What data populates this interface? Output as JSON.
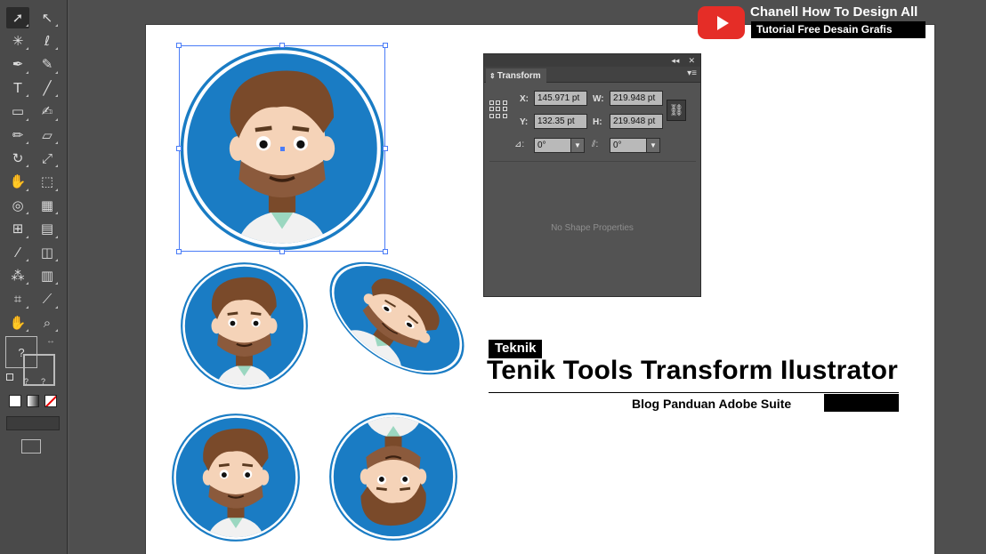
{
  "toolbar": {
    "tools": [
      {
        "name": "selection-tool-icon",
        "glyph": "➚",
        "selected": true
      },
      {
        "name": "direct-selection-tool-icon",
        "glyph": "↖"
      },
      {
        "name": "magic-wand-tool-icon",
        "glyph": "✳"
      },
      {
        "name": "lasso-tool-icon",
        "glyph": "ℓ"
      },
      {
        "name": "pen-tool-icon",
        "glyph": "✒"
      },
      {
        "name": "curvature-tool-icon",
        "glyph": "✎"
      },
      {
        "name": "type-tool-icon",
        "glyph": "T"
      },
      {
        "name": "line-tool-icon",
        "glyph": "╱"
      },
      {
        "name": "rectangle-tool-icon",
        "glyph": "▭"
      },
      {
        "name": "paintbrush-tool-icon",
        "glyph": "✍"
      },
      {
        "name": "pencil-tool-icon",
        "glyph": "✏"
      },
      {
        "name": "eraser-tool-icon",
        "glyph": "▱"
      },
      {
        "name": "rotate-tool-icon",
        "glyph": "↻"
      },
      {
        "name": "scale-tool-icon",
        "glyph": "⤢"
      },
      {
        "name": "warp-tool-icon",
        "glyph": "✋"
      },
      {
        "name": "free-transform-tool-icon",
        "glyph": "⬚"
      },
      {
        "name": "shape-builder-tool-icon",
        "glyph": "◎"
      },
      {
        "name": "perspective-grid-tool-icon",
        "glyph": "▦"
      },
      {
        "name": "mesh-tool-icon",
        "glyph": "⊞"
      },
      {
        "name": "gradient-tool-icon",
        "glyph": "▤"
      },
      {
        "name": "eyedropper-tool-icon",
        "glyph": "⁄"
      },
      {
        "name": "blend-tool-icon",
        "glyph": "◫"
      },
      {
        "name": "symbol-sprayer-tool-icon",
        "glyph": "⁂"
      },
      {
        "name": "column-graph-tool-icon",
        "glyph": "▥"
      },
      {
        "name": "artboard-tool-icon",
        "glyph": "⌗"
      },
      {
        "name": "slice-tool-icon",
        "glyph": "⟋"
      },
      {
        "name": "hand-tool-icon",
        "glyph": "✋"
      },
      {
        "name": "zoom-tool-icon",
        "glyph": "⌕"
      }
    ],
    "fill_stroke_label": "?",
    "small_label_a": "?",
    "small_label_b": "?"
  },
  "colors": {
    "avatar_blue": "#1a7cc4",
    "selection_blue": "#4a7cf7",
    "youtube_red": "#e52d27"
  },
  "transform_panel": {
    "title": "Transform",
    "x_label": "X:",
    "x_value": "145.971 pt",
    "y_label": "Y:",
    "y_value": "132.35 pt",
    "w_label": "W:",
    "w_value": "219.948 pt",
    "h_label": "H:",
    "h_value": "219.948 pt",
    "angle_value": "0°",
    "shear_value": "0°",
    "empty_message": "No Shape Properties"
  },
  "overlay": {
    "channel_name": "Chanell How To Design All",
    "channel_tagline": "Tutorial Free Desain Grafis",
    "badge": "Teknik",
    "title": "Tenik Tools Transform Ilustrator",
    "subtitle": "Blog Panduan Adobe Suite"
  }
}
